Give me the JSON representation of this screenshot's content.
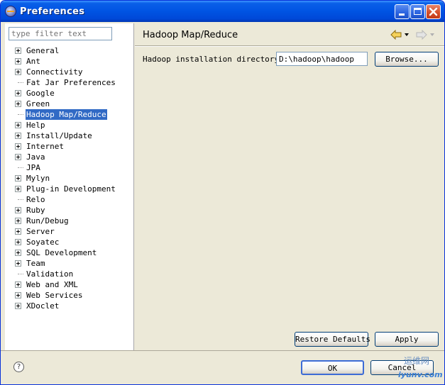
{
  "window": {
    "title": "Preferences",
    "minimize_icon": "minimize-icon",
    "maximize_icon": "maximize-icon",
    "close_icon": "close-icon"
  },
  "sidebar": {
    "filter_placeholder": "type filter text",
    "items": [
      {
        "label": "General",
        "expandable": true,
        "selected": false
      },
      {
        "label": "Ant",
        "expandable": true,
        "selected": false
      },
      {
        "label": "Connectivity",
        "expandable": true,
        "selected": false
      },
      {
        "label": "Fat Jar Preferences",
        "expandable": false,
        "selected": false
      },
      {
        "label": "Google",
        "expandable": true,
        "selected": false
      },
      {
        "label": "Green",
        "expandable": true,
        "selected": false
      },
      {
        "label": "Hadoop Map/Reduce",
        "expandable": false,
        "selected": true
      },
      {
        "label": "Help",
        "expandable": true,
        "selected": false
      },
      {
        "label": "Install/Update",
        "expandable": true,
        "selected": false
      },
      {
        "label": "Internet",
        "expandable": true,
        "selected": false
      },
      {
        "label": "Java",
        "expandable": true,
        "selected": false
      },
      {
        "label": "JPA",
        "expandable": false,
        "selected": false
      },
      {
        "label": "Mylyn",
        "expandable": true,
        "selected": false
      },
      {
        "label": "Plug-in Development",
        "expandable": true,
        "selected": false
      },
      {
        "label": "Relo",
        "expandable": false,
        "selected": false
      },
      {
        "label": "Ruby",
        "expandable": true,
        "selected": false
      },
      {
        "label": "Run/Debug",
        "expandable": true,
        "selected": false
      },
      {
        "label": "Server",
        "expandable": true,
        "selected": false
      },
      {
        "label": "Soyatec",
        "expandable": true,
        "selected": false
      },
      {
        "label": "SQL Development",
        "expandable": true,
        "selected": false
      },
      {
        "label": "Team",
        "expandable": true,
        "selected": false
      },
      {
        "label": "Validation",
        "expandable": false,
        "selected": false
      },
      {
        "label": "Web and XML",
        "expandable": true,
        "selected": false
      },
      {
        "label": "Web Services",
        "expandable": true,
        "selected": false
      },
      {
        "label": "XDoclet",
        "expandable": true,
        "selected": false
      }
    ]
  },
  "page": {
    "title": "Hadoop Map/Reduce",
    "install_dir_label": "Hadoop installation directory:",
    "install_dir_value": "D:\\hadoop\\hadoop",
    "browse_label": "Browse...",
    "restore_defaults_label": "Restore Defaults",
    "apply_label": "Apply"
  },
  "footer": {
    "ok_label": "OK",
    "cancel_label": "Cancel",
    "help_symbol": "?"
  },
  "watermark": {
    "top": "运维网",
    "bottom": "iyunv.com"
  },
  "colors": {
    "titlebar": "#0054e3",
    "dialog_bg": "#ece9d8",
    "selection": "#316ac5"
  }
}
